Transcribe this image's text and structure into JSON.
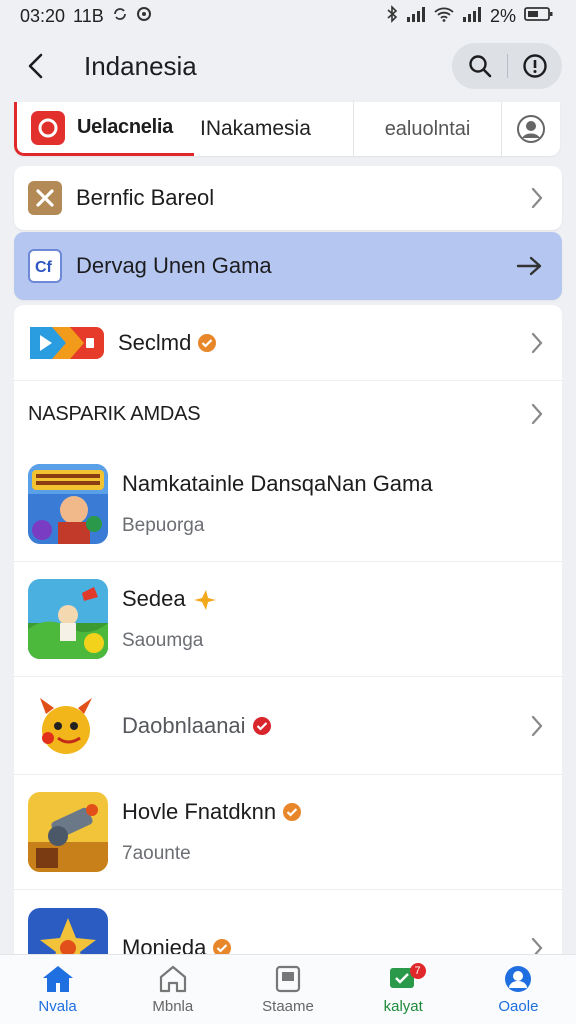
{
  "status_bar": {
    "time": "03:20",
    "carrier": "11B",
    "battery": "2%"
  },
  "header": {
    "title": "Indanesia"
  },
  "tabs": {
    "first": "Uelacnelia",
    "second": "INakamesia",
    "third": "ealuolntai"
  },
  "cards": {
    "card1": "Bernfic Bareol",
    "card2": "Dervag Unen Gama"
  },
  "featured": {
    "name": "Seclmd"
  },
  "section": {
    "title": "NASPARIK AMDAS"
  },
  "games": [
    {
      "name": "Namkatainle DansqaNan Gama",
      "sub": "Bepuorga"
    },
    {
      "name": "Sedea",
      "sub": "Saoumga"
    },
    {
      "name": "Daobnlaanai",
      "sub": ""
    },
    {
      "name": "Hovle Fnatdknn",
      "sub": "7aounte"
    },
    {
      "name": "Monieda",
      "sub": ""
    }
  ],
  "bottom_nav": [
    {
      "label": "Nvala"
    },
    {
      "label": "Mbnla"
    },
    {
      "label": "Staame"
    },
    {
      "label": "kalyat",
      "badge": "7"
    },
    {
      "label": "Oaole"
    }
  ],
  "colors": {
    "accent": "#1f6fe0",
    "highlight_card": "#b5c6f0",
    "brand_red": "#e0282a",
    "verified_orange": "#e8862a",
    "verified_red": "#d8262c"
  }
}
